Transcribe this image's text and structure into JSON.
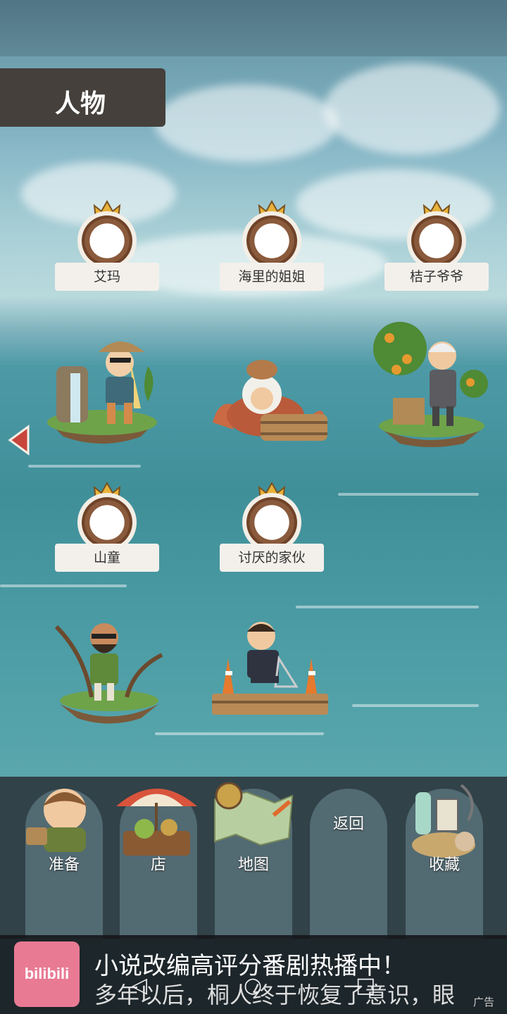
{
  "header": {
    "title": "人物"
  },
  "characters": [
    {
      "name": "艾玛",
      "icon": "emma-avatar-icon"
    },
    {
      "name": "海里的姐姐",
      "icon": "sea-sister-avatar-icon"
    },
    {
      "name": "桔子爷爷",
      "icon": "orange-grandpa-avatar-icon"
    },
    {
      "name": "山童",
      "icon": "mountain-boy-avatar-icon"
    },
    {
      "name": "讨厌的家伙",
      "icon": "annoying-guy-avatar-icon"
    }
  ],
  "bottom_nav": {
    "prepare": "准备",
    "shop": "店",
    "map": "地图",
    "back": "返回",
    "collection": "收藏"
  },
  "ad": {
    "logo": "bilibili",
    "title": "小说改编高评分番剧热播中！",
    "subtitle": "多年以后，桐人终于恢复了意识，眼",
    "tag": "广告"
  },
  "colors": {
    "title_bg": "#45403c",
    "badge_ring": "#8a5a3c",
    "crown": "#e8b23a",
    "arrow": "#c8453c"
  }
}
